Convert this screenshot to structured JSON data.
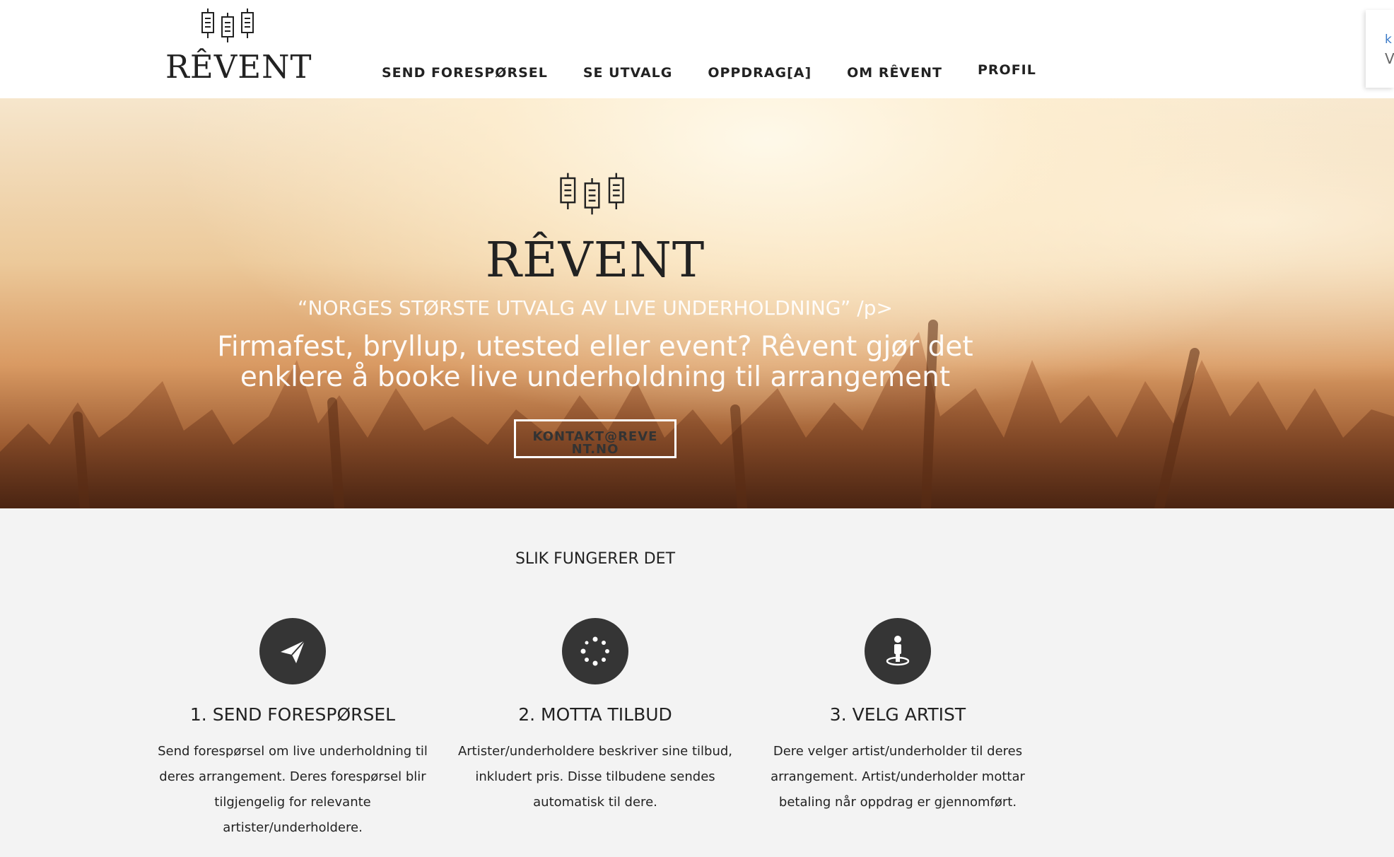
{
  "brand": {
    "name": "RÊVENT"
  },
  "nav": {
    "items": [
      "SEND FORESPØRSEL",
      "SE UTVALG",
      "OPPDRAG[A]",
      "OM RÊVENT",
      "PROFIL"
    ]
  },
  "corner": {
    "line1": "k",
    "line2": "V"
  },
  "hero": {
    "title": "RÊVENT",
    "tagline": "“NORGES STØRSTE UTVALG AV LIVE UNDERHOLDNING” /p>",
    "subtitle": "Firmafest, bryllup, utested eller event? Rêvent gjør det enklere å booke live underholdning til arrangement",
    "button": "KONTAKT@REVENT.NO"
  },
  "how": {
    "title": "SLIK FUNGERER DET",
    "steps": [
      {
        "icon": "paper-plane-icon",
        "title": "1. SEND FORESPØRSEL",
        "text": "Send forespørsel om live underholdning til deres arrangement. Deres forespørsel blir tilgjengelig for relevante artister/underholdere."
      },
      {
        "icon": "spinner-icon",
        "title": "2. MOTTA TILBUD",
        "text": "Artister/underholdere beskriver sine tilbud, inkludert pris. Disse tilbudene sendes automatisk til dere."
      },
      {
        "icon": "person-pin-icon",
        "title": "3. VELG ARTIST",
        "text": "Dere velger artist/underholder til deres arrangement. Artist/underholder mottar betaling når oppdrag er gjennomført."
      }
    ]
  }
}
